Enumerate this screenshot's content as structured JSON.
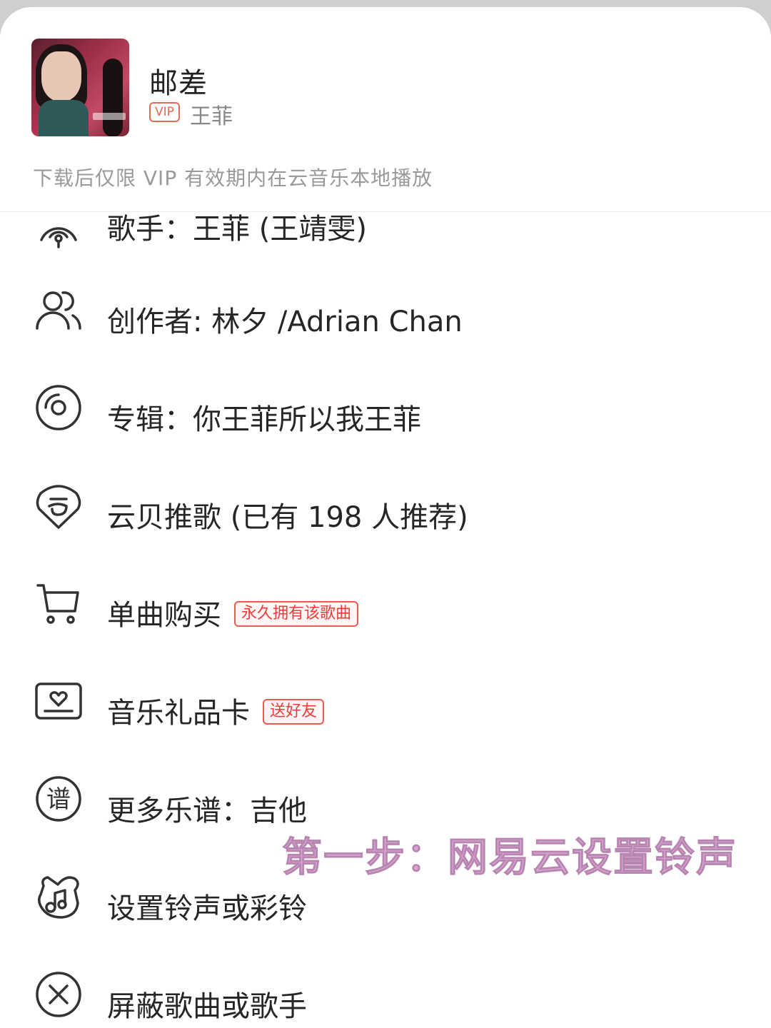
{
  "song": {
    "title": "邮差",
    "vip_label": "VIP",
    "artist": "王菲",
    "notice": "下载后仅限 VIP 有效期内在云音乐本地播放"
  },
  "menu": {
    "items": [
      {
        "label": "歌手：王菲 (王靖雯)",
        "icon": "singer-icon"
      },
      {
        "label": "创作者: 林夕 /Adrian Chan",
        "icon": "creators-icon"
      },
      {
        "label": "专辑：你王菲所以我王菲",
        "icon": "album-disc-icon"
      },
      {
        "label": "云贝推歌 (已有 198 人推荐)",
        "icon": "cloud-coin-icon"
      },
      {
        "label": "单曲购买",
        "tag": "永久拥有该歌曲",
        "icon": "cart-icon"
      },
      {
        "label": "音乐礼品卡",
        "tag": "送好友",
        "icon": "gift-card-icon"
      },
      {
        "label": "更多乐谱：吉他",
        "icon": "score-icon",
        "icon_char": "谱"
      },
      {
        "label": "设置铃声或彩铃",
        "icon": "ringtone-icon"
      },
      {
        "label": "屏蔽歌曲或歌手",
        "icon": "block-icon"
      }
    ]
  },
  "overlay": {
    "caption": "第一步：网易云设置铃声"
  },
  "colors": {
    "accent_red": "#ee3b3b",
    "vip_orange": "#e56a55",
    "caption_pink": "#d7a6d2"
  }
}
